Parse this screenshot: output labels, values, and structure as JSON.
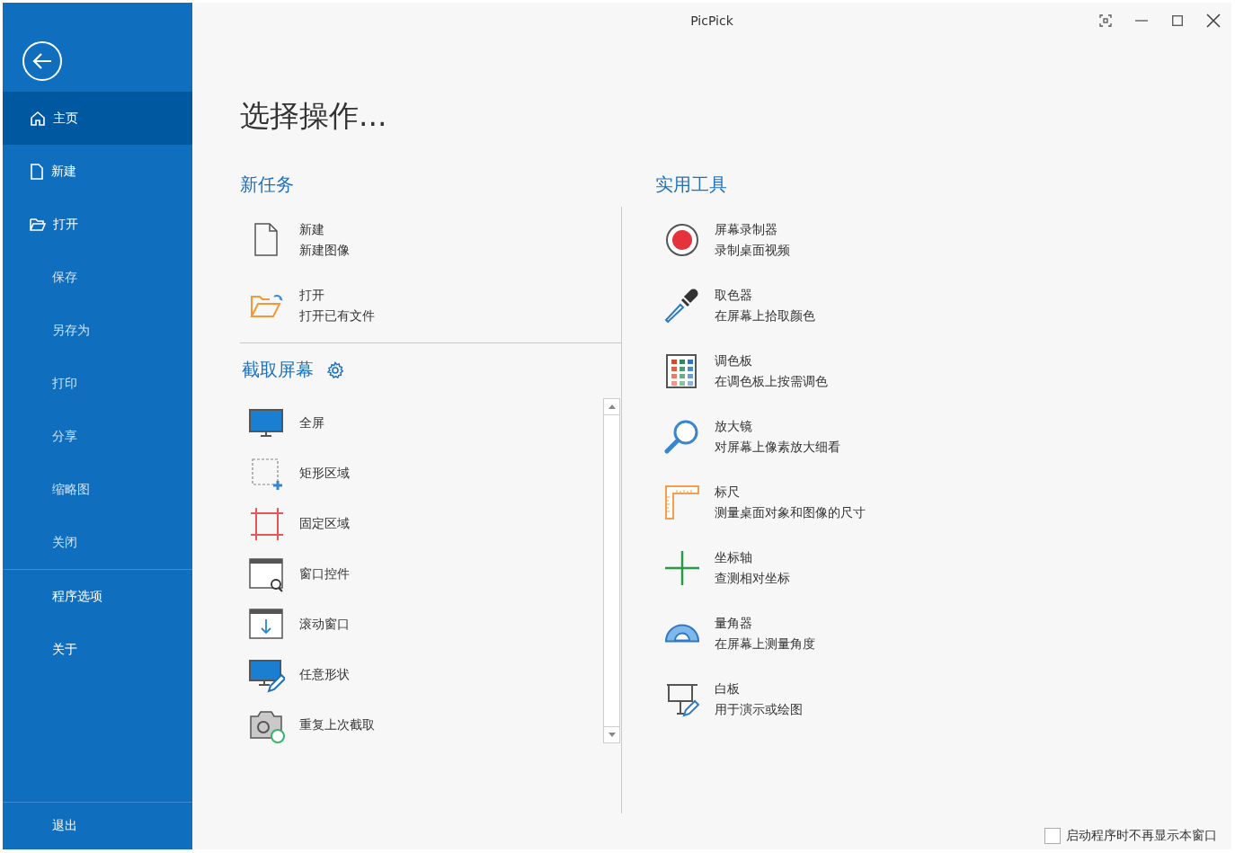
{
  "window": {
    "title": "PicPick"
  },
  "sidebar": {
    "items": [
      {
        "label": "主页",
        "kind": "main",
        "selected": true
      },
      {
        "label": "新建",
        "kind": "main",
        "selected": false
      },
      {
        "label": "打开",
        "kind": "main",
        "selected": false
      },
      {
        "label": "保存",
        "kind": "sub",
        "selected": false
      },
      {
        "label": "另存为",
        "kind": "sub",
        "selected": false
      },
      {
        "label": "打印",
        "kind": "sub",
        "selected": false
      },
      {
        "label": "分享",
        "kind": "sub",
        "selected": false
      },
      {
        "label": "缩略图",
        "kind": "sub",
        "selected": false
      },
      {
        "label": "关闭",
        "kind": "sub",
        "selected": false
      },
      {
        "label": "程序选项",
        "kind": "option",
        "selected": false
      },
      {
        "label": "关于",
        "kind": "option",
        "selected": false
      }
    ],
    "exit": "退出"
  },
  "heading": "选择操作...",
  "new_task": {
    "title": "新任务",
    "items": [
      {
        "title": "新建",
        "subtitle": "新建图像"
      },
      {
        "title": "打开",
        "subtitle": "打开已有文件"
      }
    ]
  },
  "capture": {
    "title": "截取屏幕",
    "items": [
      "全屏",
      "矩形区域",
      "固定区域",
      "窗口控件",
      "滚动窗口",
      "任意形状",
      "重复上次截取"
    ]
  },
  "tools": {
    "title": "实用工具",
    "items": [
      {
        "title": "屏幕录制器",
        "subtitle": "录制桌面视频"
      },
      {
        "title": "取色器",
        "subtitle": "在屏幕上拾取颜色"
      },
      {
        "title": "调色板",
        "subtitle": "在调色板上按需调色"
      },
      {
        "title": "放大镜",
        "subtitle": "对屏幕上像素放大细看"
      },
      {
        "title": "标尺",
        "subtitle": "测量桌面对象和图像的尺寸"
      },
      {
        "title": "坐标轴",
        "subtitle": "查测相对坐标"
      },
      {
        "title": "量角器",
        "subtitle": "在屏幕上测量角度"
      },
      {
        "title": "白板",
        "subtitle": "用于演示或绘图"
      }
    ]
  },
  "dont_show_again": {
    "label": "启动程序时不再显示本窗口",
    "checked": false
  }
}
